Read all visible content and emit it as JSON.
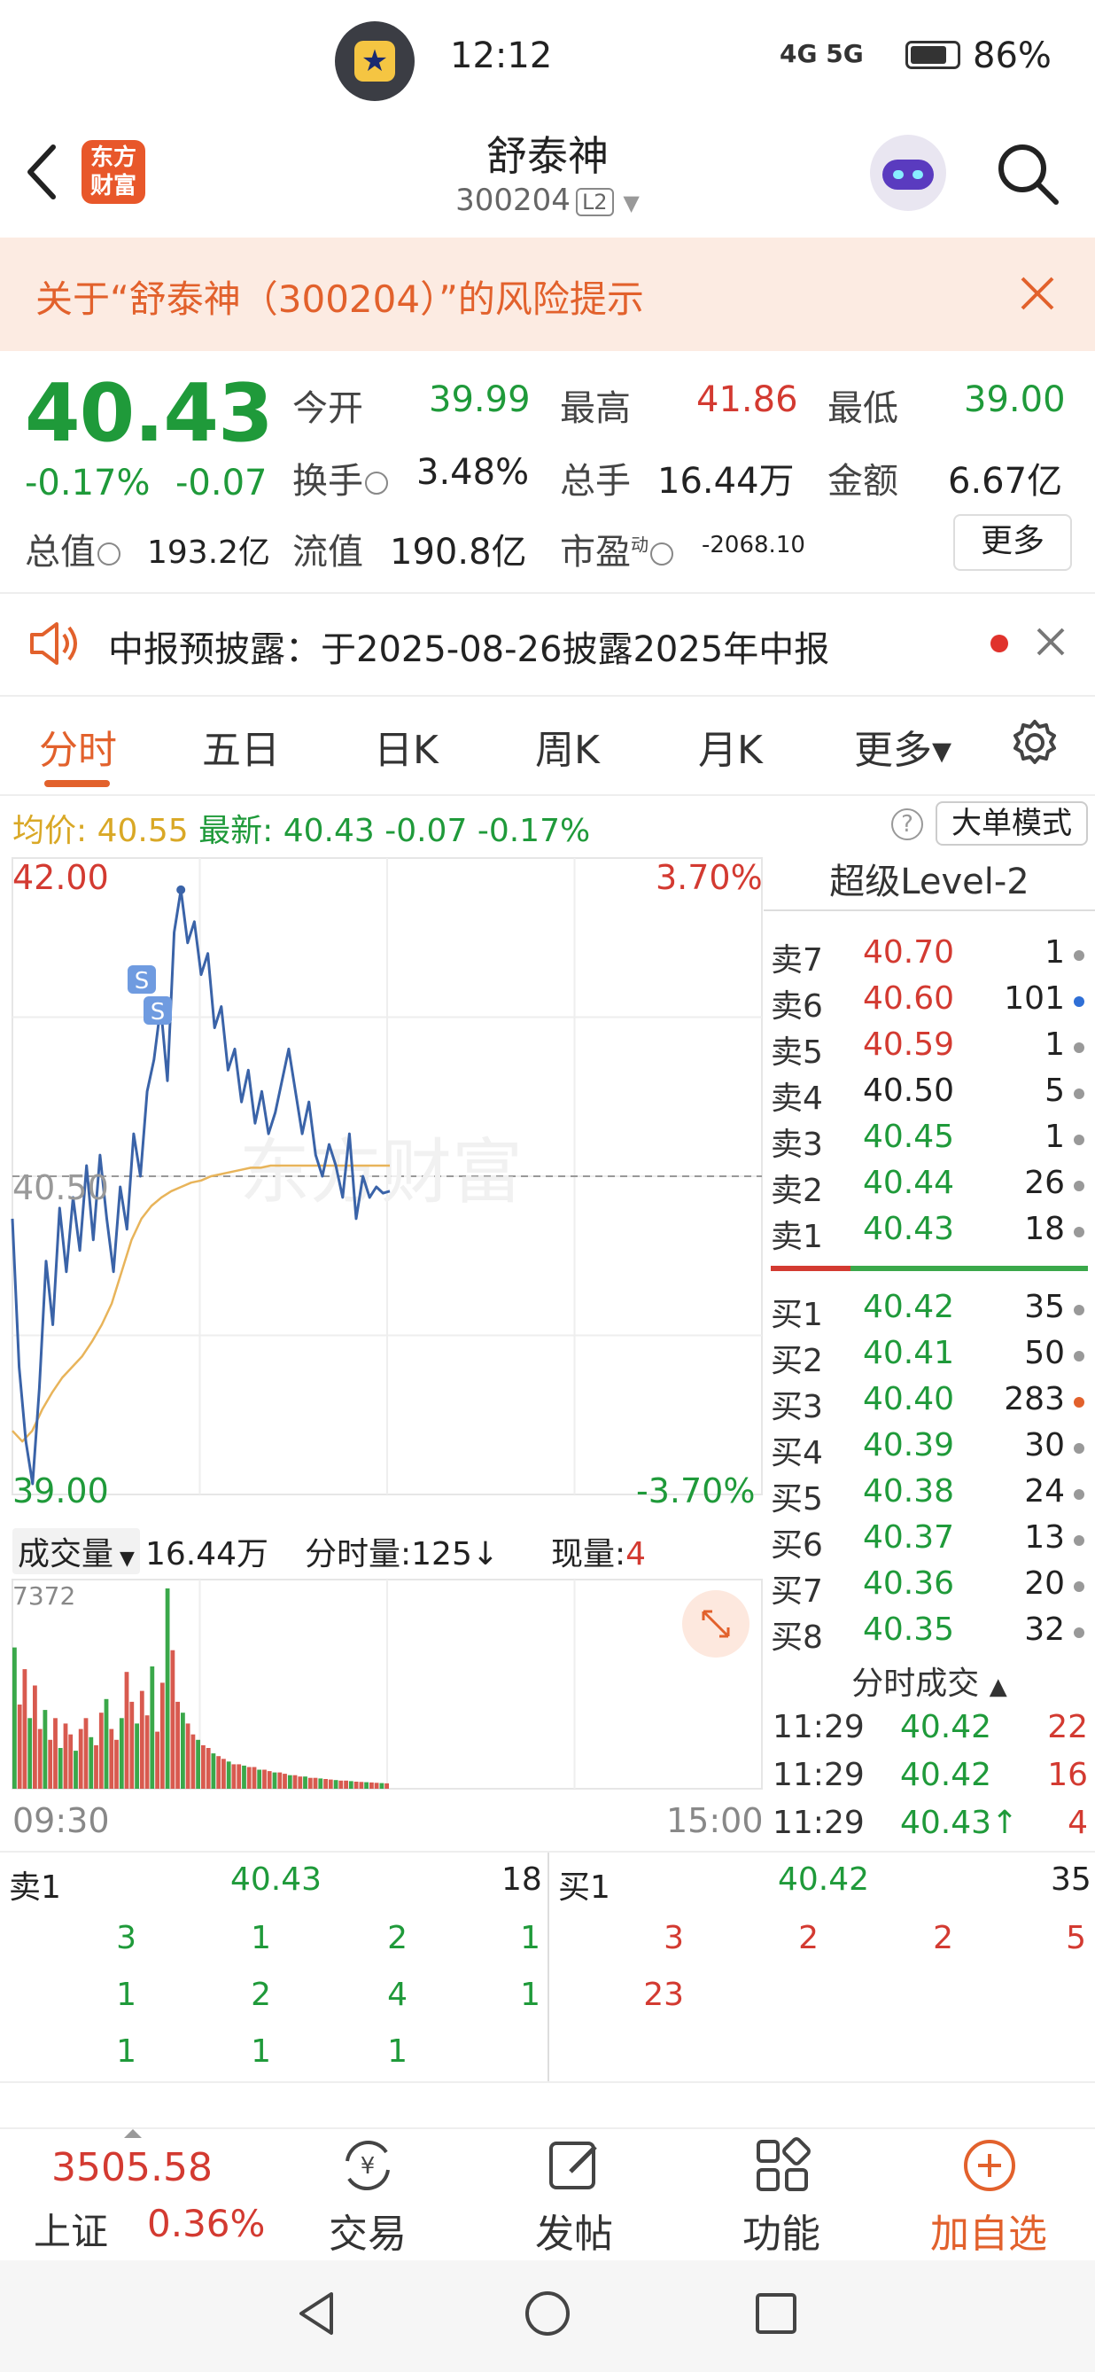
{
  "status_bar": {
    "time": "12:12",
    "signal": "4G 5G",
    "battery": "86%"
  },
  "header": {
    "logo_text_1": "东方",
    "logo_text_2": "财富",
    "title": "舒泰神",
    "code": "300204",
    "level_tag": "L2"
  },
  "risk_banner": {
    "text": "关于“舒泰神（300204）”的风险提示"
  },
  "quote": {
    "price": "40.43",
    "change_pct": "-0.17%",
    "change_abs": "-0.07",
    "open_label": "今开",
    "open": "39.99",
    "high_label": "最高",
    "high": "41.86",
    "low_label": "最低",
    "low": "39.00",
    "turnover_label": "换手",
    "turnover": "3.48%",
    "volume_label": "总手",
    "volume": "16.44万",
    "amount_label": "金额",
    "amount": "6.67亿",
    "mktcap_label": "总值",
    "mktcap": "193.2亿",
    "float_label": "流值",
    "float_cap": "190.8亿",
    "pe_label": "市盈",
    "pe_sup": "动",
    "pe": "-2068.10",
    "more_label": "更多"
  },
  "notice": {
    "text": "中报预披露：于2025-08-26披露2025年中报"
  },
  "tabs": [
    "分时",
    "五日",
    "日K",
    "周K",
    "月K",
    "更多▾"
  ],
  "avg_bar": {
    "avg_label": "均价:",
    "avg": "40.55",
    "last_label": "最新:",
    "last": "40.43",
    "chg": "-0.07",
    "pct": "-0.17%",
    "mode_button": "大单模式",
    "help": "?"
  },
  "chart_data": {
    "type": "line",
    "y_max_label": "42.00",
    "y_min_label": "39.00",
    "y_mid_label": "40.50",
    "pct_max_label": "3.70%",
    "pct_min_label": "-3.70%",
    "ylim": [
      39.0,
      42.0
    ],
    "x_start_label": "09:30",
    "x_end_label": "15:00",
    "series": [
      {
        "values": [
          40.3,
          39.6,
          39.25,
          39.05,
          39.5,
          40.1,
          39.8,
          40.35,
          40.05,
          40.4,
          40.15,
          40.55,
          40.2,
          40.6,
          40.3,
          40.05,
          40.45,
          40.25,
          40.7,
          40.5,
          40.9,
          41.05,
          41.3,
          40.95,
          41.65,
          41.85,
          41.6,
          41.7,
          41.45,
          41.55,
          41.2,
          41.3,
          41.0,
          41.1,
          40.85,
          41.0,
          40.75,
          40.9,
          40.7,
          40.8,
          40.95,
          41.1,
          40.9,
          40.7,
          40.85,
          40.6,
          40.5,
          40.65,
          40.55,
          40.4,
          40.7,
          40.3,
          40.5,
          40.4,
          40.45,
          40.42,
          40.43
        ]
      },
      {
        "values": [
          39.3,
          39.25,
          39.3,
          39.4,
          39.48,
          39.55,
          39.6,
          39.65,
          39.72,
          39.8,
          39.9,
          40.05,
          40.2,
          40.3,
          40.36,
          40.4,
          40.43,
          40.45,
          40.47,
          40.48,
          40.5,
          40.51,
          40.52,
          40.53,
          40.54,
          40.54,
          40.55,
          40.55,
          40.55,
          40.55,
          40.55,
          40.55,
          40.55,
          40.55,
          40.55,
          40.55,
          40.55,
          40.55,
          40.55
        ]
      }
    ]
  },
  "volume_bar": {
    "label": "成交量",
    "total": "16.44万",
    "tick_label": "分时量:125",
    "now_label": "现量:",
    "now": "4",
    "max_label": "7372"
  },
  "volume_data": [
    5200,
    3100,
    4400,
    2600,
    3800,
    2200,
    2900,
    1800,
    2600,
    1500,
    2400,
    2000,
    1400,
    2200,
    2600,
    1900,
    1600,
    2800,
    3300,
    2200,
    1800,
    2600,
    4300,
    3200,
    2400,
    3600,
    2700,
    4500,
    2100,
    3900,
    7372,
    5100,
    3200,
    2800,
    2400,
    2000,
    1800,
    1600,
    1500,
    1300,
    1200,
    1100,
    1000,
    900,
    900,
    850,
    800,
    800,
    700,
    700,
    650,
    600,
    600,
    550,
    500,
    500,
    450,
    450,
    400,
    400,
    380,
    360,
    340,
    320,
    300,
    300,
    280,
    260,
    250,
    240,
    230,
    220,
    210,
    200
  ],
  "orderbook": {
    "title": "超级Level-2",
    "asks": [
      {
        "label": "卖7",
        "price": "40.70",
        "qty": "1"
      },
      {
        "label": "卖6",
        "price": "40.60",
        "qty": "101"
      },
      {
        "label": "卖5",
        "price": "40.59",
        "qty": "1"
      },
      {
        "label": "卖4",
        "price": "40.50",
        "qty": "5"
      },
      {
        "label": "卖3",
        "price": "40.45",
        "qty": "1"
      },
      {
        "label": "卖2",
        "price": "40.44",
        "qty": "26"
      },
      {
        "label": "卖1",
        "price": "40.43",
        "qty": "18"
      }
    ],
    "bids": [
      {
        "label": "买1",
        "price": "40.42",
        "qty": "35"
      },
      {
        "label": "买2",
        "price": "40.41",
        "qty": "50"
      },
      {
        "label": "买3",
        "price": "40.40",
        "qty": "283"
      },
      {
        "label": "买4",
        "price": "40.39",
        "qty": "30"
      },
      {
        "label": "买5",
        "price": "40.38",
        "qty": "24"
      },
      {
        "label": "买6",
        "price": "40.37",
        "qty": "13"
      },
      {
        "label": "买7",
        "price": "40.36",
        "qty": "20"
      },
      {
        "label": "买8",
        "price": "40.35",
        "qty": "32"
      }
    ],
    "ticks_title": "分时成交",
    "ticks": [
      {
        "time": "11:29",
        "price": "40.42",
        "vol": "22"
      },
      {
        "time": "11:29",
        "price": "40.42",
        "vol": "16"
      },
      {
        "time": "11:29",
        "price": "40.43↑",
        "vol": "4"
      }
    ]
  },
  "depth": {
    "sell_label": "卖1",
    "sell_price": "40.43",
    "sell_qty": "18",
    "buy_label": "买1",
    "buy_price": "40.42",
    "buy_qty": "35",
    "sell_queue": [
      [
        "3",
        "1",
        "2",
        "1"
      ],
      [
        "1",
        "2",
        "4",
        "1"
      ],
      [
        "1",
        "1",
        "1"
      ]
    ],
    "buy_queue": [
      [
        "3",
        "2",
        "2",
        "5"
      ],
      [
        "23"
      ]
    ]
  },
  "bottom_nav": {
    "index_value": "3505.58",
    "index_name": "上证",
    "index_pct": "0.36%",
    "trade": "交易",
    "post": "发帖",
    "func": "功能",
    "watch": "加自选"
  }
}
